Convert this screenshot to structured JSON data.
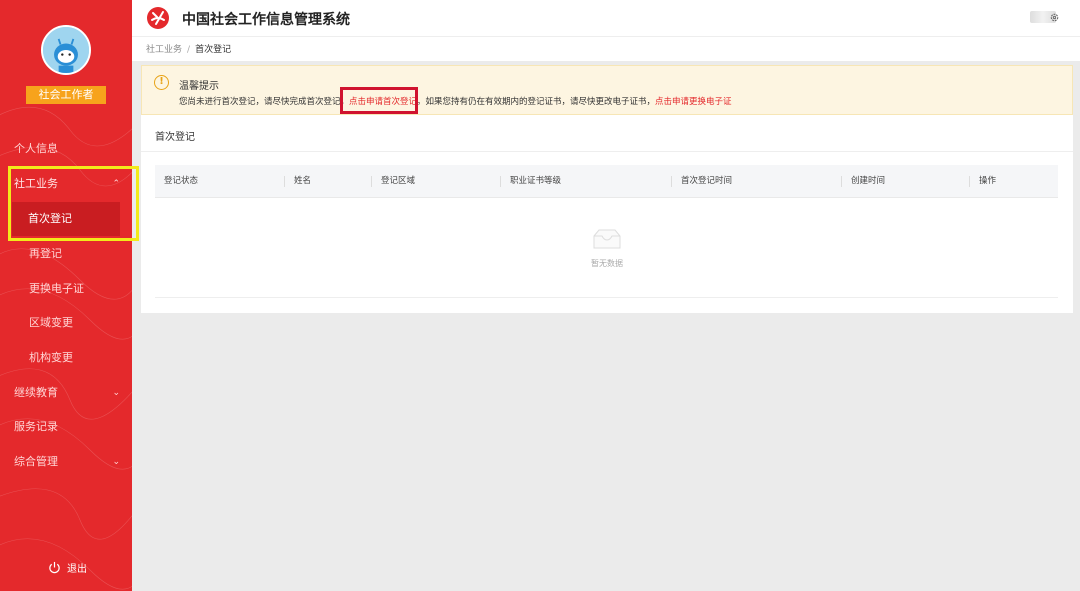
{
  "app": {
    "title": "中国社会工作信息管理系统"
  },
  "user": {
    "role": "社会工作者"
  },
  "breadcrumb": {
    "parent": "社工业务",
    "separator": "/",
    "current": "首次登记"
  },
  "sidebar": {
    "items": [
      {
        "label": "个人信息"
      },
      {
        "label": "社工业务",
        "chevron": "⌃"
      },
      {
        "label": "首次登记"
      },
      {
        "label": "再登记"
      },
      {
        "label": "更换电子证"
      },
      {
        "label": "区域变更"
      },
      {
        "label": "机构变更"
      },
      {
        "label": "继续教育",
        "chevron": "⌄"
      },
      {
        "label": "服务记录"
      },
      {
        "label": "综合管理",
        "chevron": "⌄"
      }
    ],
    "logout": "退出"
  },
  "alert": {
    "title": "温馨提示",
    "text1": "您尚未进行首次登记，请尽快完成首次登记，",
    "link1": "点击申请首次登记",
    "text2": "。如果您持有仍在有效期内的登记证书，请尽快更改电子证书，",
    "link2": "点击申请更换电子证"
  },
  "section": {
    "title": "首次登记"
  },
  "table": {
    "columns": [
      "登记状态",
      "姓名",
      "登记区域",
      "职业证书等级",
      "首次登记时间",
      "创建时间",
      "操作"
    ],
    "empty_text": "暂无数据"
  },
  "colors": {
    "primary": "#e4292c",
    "badge": "#f7a31c",
    "highlight_yellow": "#f2ea1a",
    "highlight_red": "#d0132f"
  },
  "icons": {
    "logo": "logo-icon",
    "settings": "gear-icon",
    "logout": "power-icon",
    "alert": "warning-icon",
    "empty": "empty-box-icon"
  }
}
